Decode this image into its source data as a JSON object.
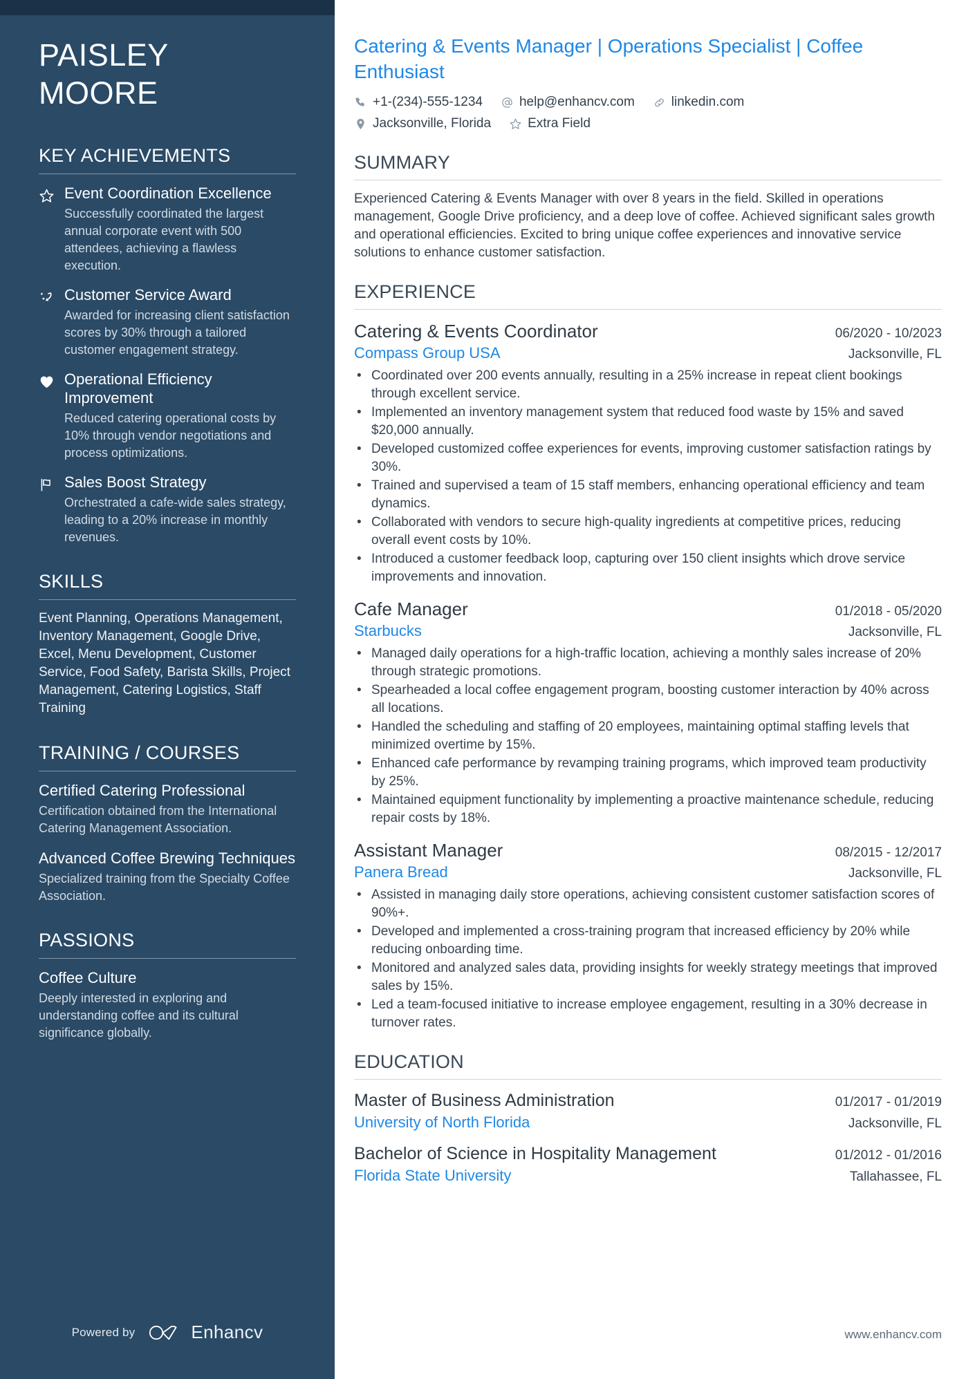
{
  "theme": {
    "sidebar_bg": "#2a4a66",
    "sidebar_topbar": "#1b3147",
    "accent_blue": "#1e88e5",
    "body_text": "#39444f"
  },
  "sidebar": {
    "name_first": "PAISLEY",
    "name_last": "MOORE",
    "achievements": {
      "heading": "KEY ACHIEVEMENTS",
      "items": [
        {
          "icon": "star-outline-icon",
          "title": "Event Coordination Excellence",
          "desc": "Successfully coordinated the largest annual corporate event with 500 attendees, achieving a flawless execution."
        },
        {
          "icon": "magic-wand-icon",
          "title": "Customer Service Award",
          "desc": "Awarded for increasing client satisfaction scores by 30% through a tailored customer engagement strategy."
        },
        {
          "icon": "heart-filled-icon",
          "title": "Operational Efficiency Improvement",
          "desc": "Reduced catering operational costs by 10% through vendor negotiations and process optimizations."
        },
        {
          "icon": "flag-outline-icon",
          "title": "Sales Boost Strategy",
          "desc": "Orchestrated a cafe-wide sales strategy, leading to a 20% increase in monthly revenues."
        }
      ]
    },
    "skills": {
      "heading": "SKILLS",
      "text": "Event Planning, Operations Management, Inventory Management, Google Drive, Excel, Menu Development, Customer Service, Food Safety, Barista Skills, Project Management, Catering Logistics, Staff Training"
    },
    "training": {
      "heading": "TRAINING / COURSES",
      "items": [
        {
          "title": "Certified Catering Professional",
          "desc": "Certification obtained from the International Catering Management Association."
        },
        {
          "title": "Advanced Coffee Brewing Techniques",
          "desc": "Specialized training from the Specialty Coffee Association."
        }
      ]
    },
    "passions": {
      "heading": "PASSIONS",
      "items": [
        {
          "title": "Coffee Culture",
          "desc": "Deeply interested in exploring and understanding coffee and its cultural significance globally."
        }
      ]
    },
    "footer": {
      "powered_by": "Powered by",
      "brand": "Enhancv"
    }
  },
  "main": {
    "headline": "Catering & Events Manager | Operations Specialist | Coffee Enthusiast",
    "contacts": [
      {
        "icon": "phone-icon",
        "value": "+1-(234)-555-1234"
      },
      {
        "icon": "at-sign-icon",
        "value": "help@enhancv.com"
      },
      {
        "icon": "link-icon",
        "value": "linkedin.com"
      },
      {
        "icon": "map-pin-icon",
        "value": "Jacksonville, Florida"
      },
      {
        "icon": "star-outline-icon",
        "value": "Extra Field"
      }
    ],
    "summary": {
      "heading": "SUMMARY",
      "text": "Experienced Catering & Events Manager with over 8 years in the field. Skilled in operations management, Google Drive proficiency, and a deep love of coffee. Achieved significant sales growth and operational efficiencies. Excited to bring unique coffee experiences and innovative service solutions to enhance customer satisfaction."
    },
    "experience": {
      "heading": "EXPERIENCE",
      "jobs": [
        {
          "title": "Catering & Events Coordinator",
          "dates": "06/2020 - 10/2023",
          "company": "Compass Group USA",
          "location": "Jacksonville, FL",
          "bullets": [
            "Coordinated over 200 events annually, resulting in a 25% increase in repeat client bookings through excellent service.",
            "Implemented an inventory management system that reduced food waste by 15% and saved $20,000 annually.",
            "Developed customized coffee experiences for events, improving customer satisfaction ratings by 30%.",
            "Trained and supervised a team of 15 staff members, enhancing operational efficiency and team dynamics.",
            "Collaborated with vendors to secure high-quality ingredients at competitive prices, reducing overall event costs by 10%.",
            "Introduced a customer feedback loop, capturing over 150 client insights which drove service improvements and innovation."
          ]
        },
        {
          "title": "Cafe Manager",
          "dates": "01/2018 - 05/2020",
          "company": "Starbucks",
          "location": "Jacksonville, FL",
          "bullets": [
            "Managed daily operations for a high-traffic location, achieving a monthly sales increase of 20% through strategic promotions.",
            "Spearheaded a local coffee engagement program, boosting customer interaction by 40% across all locations.",
            "Handled the scheduling and staffing of 20 employees, maintaining optimal staffing levels that minimized overtime by 15%.",
            "Enhanced cafe performance by revamping training programs, which improved team productivity by 25%.",
            "Maintained equipment functionality by implementing a proactive maintenance schedule, reducing repair costs by 18%."
          ]
        },
        {
          "title": "Assistant Manager",
          "dates": "08/2015 - 12/2017",
          "company": "Panera Bread",
          "location": "Jacksonville, FL",
          "bullets": [
            "Assisted in managing daily store operations, achieving consistent customer satisfaction scores of 90%+.",
            "Developed and implemented a cross-training program that increased efficiency by 20% while reducing onboarding time.",
            "Monitored and analyzed sales data, providing insights for weekly strategy meetings that improved sales by 15%.",
            "Led a team-focused initiative to increase employee engagement, resulting in a 30% decrease in turnover rates."
          ]
        }
      ]
    },
    "education": {
      "heading": "EDUCATION",
      "items": [
        {
          "degree": "Master of Business Administration",
          "dates": "01/2017 - 01/2019",
          "school": "University of North Florida",
          "location": "Jacksonville, FL"
        },
        {
          "degree": "Bachelor of Science in Hospitality Management",
          "dates": "01/2012 - 01/2016",
          "school": "Florida State University",
          "location": "Tallahassee, FL"
        }
      ]
    },
    "footer_url": "www.enhancv.com"
  }
}
